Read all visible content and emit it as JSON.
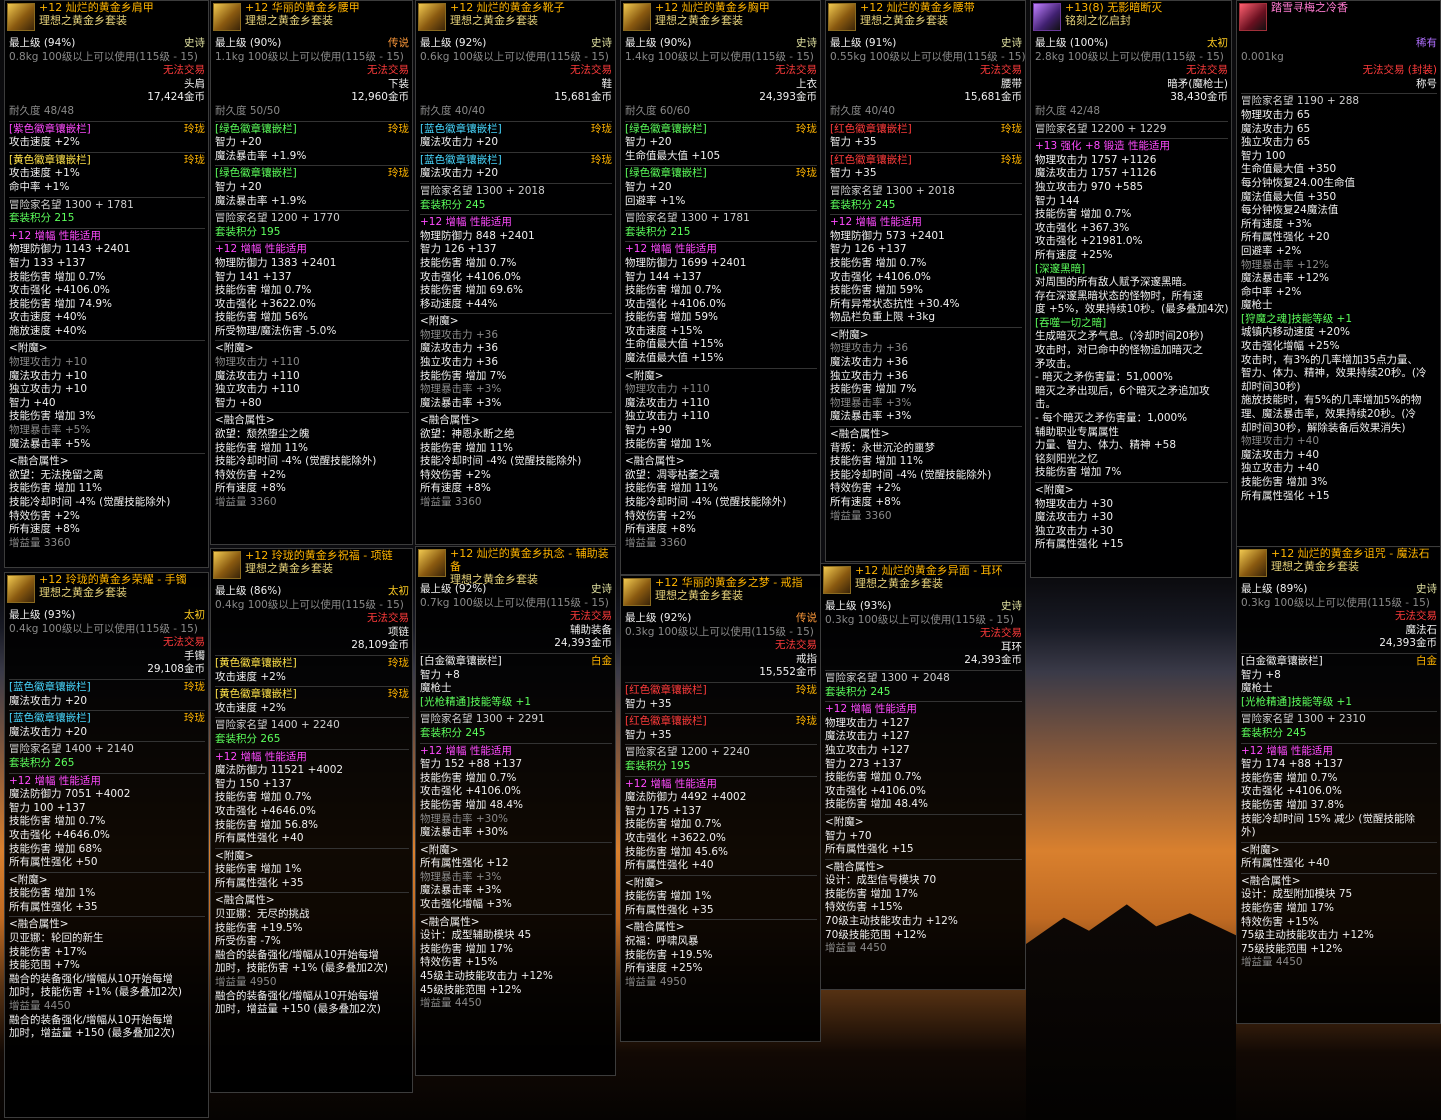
{
  "tips": [
    {
      "id": "shoulder",
      "title": "+12 灿烂的黄金乡肩甲",
      "set": "理想之黄金乡套装",
      "tier": "史诗",
      "level": "最上级",
      "pct": "(94%)",
      "weight": "0.8kg",
      "req": "100级以上可以使用(115级 - 15)",
      "trade": "无法交易",
      "slot": "头肩",
      "price": "17,424金币",
      "dur": "耐久度 48/48",
      "lines": [
        "[紫色徽章镶嵌栏]|玲珑",
        "攻击速度 +2%",
        "[黄色徽章镶嵌栏]|玲珑",
        "攻击速度 +1%",
        "命中率 +1%",
        "冒险家名望 1300 + 1781",
        "套装积分 215",
        "+12 增幅 性能适用",
        "物理防御力 1143 +2401",
        "智力 133 +137",
        "技能伤害 增加 0.7%",
        "攻击强化 +4106.0%",
        "技能伤害 增加 74.9%",
        "攻击速度 +40%",
        "施放速度 +40%",
        "<附魔>",
        "物理攻击力 +10",
        "魔法攻击力 +10",
        "独立攻击力 +10",
        "智力 +40",
        "技能伤害 增加 3%",
        "物理暴击率 +5%",
        "魔法暴击率 +5%",
        "<融合属性>",
        "欲望：无法挽留之离",
        "技能伤害 增加 11%",
        "技能冷却时间 -4% (觉醒技能除外)",
        "特效伤害 +2%",
        "所有速度 +8%",
        "增益量 3360"
      ]
    },
    {
      "id": "pants",
      "title": "+12 华丽的黄金乡腰甲",
      "set": "理想之黄金乡套装",
      "tier": "传说",
      "level": "最上级",
      "pct": "(90%)",
      "weight": "1.1kg",
      "req": "100级以上可以使用(115级 - 15)",
      "trade": "无法交易",
      "slot": "下装",
      "price": "12,960金币",
      "dur": "耐久度 50/50",
      "lines": [
        "[绿色徽章镶嵌栏]|玲珑",
        "智力 +20",
        "魔法暴击率 +1.9%",
        "[绿色徽章镶嵌栏]|玲珑",
        "智力 +20",
        "魔法暴击率 +1.9%",
        "冒险家名望 1200 + 1770",
        "套装积分 195",
        "+12 增幅 性能适用",
        "物理防御力 1383 +2401",
        "智力 141 +137",
        "技能伤害 增加 0.7%",
        "攻击强化 +3622.0%",
        "技能伤害 增加 56%",
        "所受物理/魔法伤害 -5.0%",
        "<附魔>",
        "物理攻击力 +110",
        "魔法攻击力 +110",
        "独立攻击力 +110",
        "智力 +80",
        "<融合属性>",
        "欲望：颓然堕尘之魄",
        "技能伤害 增加 11%",
        "技能冷却时间 -4% (觉醒技能除外)",
        "特效伤害 +2%",
        "所有速度 +8%",
        "增益量 3360"
      ]
    },
    {
      "id": "shoes",
      "title": "+12 灿烂的黄金乡靴子",
      "set": "理想之黄金乡套装",
      "tier": "史诗",
      "level": "最上级",
      "pct": "(92%)",
      "weight": "0.6kg",
      "req": "100级以上可以使用(115级 - 15)",
      "trade": "无法交易",
      "slot": "鞋",
      "price": "15,681金币",
      "dur": "耐久度 40/40",
      "lines": [
        "[蓝色徽章镶嵌栏]|玲珑",
        "魔法攻击力 +20",
        "[蓝色徽章镶嵌栏]|玲珑",
        "魔法攻击力 +20",
        "冒险家名望 1300 + 2018",
        "套装积分 245",
        "+12 增幅 性能适用",
        "物理防御力 848 +2401",
        "智力 126 +137",
        "技能伤害 增加 0.7%",
        "攻击强化 +4106.0%",
        "技能伤害 增加 69.6%",
        "移动速度 +44%",
        "<附魔>",
        "物理攻击力 +36",
        "魔法攻击力 +36",
        "独立攻击力 +36",
        "技能伤害 增加 7%",
        "物理暴击率 +3%",
        "魔法暴击率 +3%",
        "<融合属性>",
        "欲望：神恩永断之绝",
        "技能伤害 增加 11%",
        "技能冷却时间 -4% (觉醒技能除外)",
        "特效伤害 +2%",
        "所有速度 +8%",
        "增益量 3360"
      ]
    },
    {
      "id": "chest",
      "title": "+12 灿烂的黄金乡胸甲",
      "set": "理想之黄金乡套装",
      "tier": "史诗",
      "level": "最上级",
      "pct": "(90%)",
      "weight": "1.4kg",
      "req": "100级以上可以使用(115级 - 15)",
      "trade": "无法交易",
      "slot": "上衣",
      "price": "24,393金币",
      "dur": "耐久度 60/60",
      "lines": [
        "[绿色徽章镶嵌栏]|玲珑",
        "智力 +20",
        "生命值最大值 +105",
        "[绿色徽章镶嵌栏]|玲珑",
        "智力 +20",
        "回避率 +1%",
        "冒险家名望 1300 + 1781",
        "套装积分 215",
        "+12 增幅 性能适用",
        "物理防御力 1699 +2401",
        "智力 144 +137",
        "技能伤害 增加 0.7%",
        "攻击强化 +4106.0%",
        "技能伤害 增加 59%",
        "攻击速度 +15%",
        "生命值最大值 +15%",
        "魔法值最大值 +15%",
        "<附魔>",
        "物理攻击力 +110",
        "魔法攻击力 +110",
        "独立攻击力 +110",
        "智力 +90",
        "技能伤害 增加 1%",
        "<融合属性>",
        "欲望：凋零枯萎之魂",
        "技能伤害 增加 11%",
        "技能冷却时间 -4% (觉醒技能除外)",
        "特效伤害 +2%",
        "所有速度 +8%",
        "增益量 3360"
      ]
    },
    {
      "id": "belt",
      "title": "+12 灿烂的黄金乡腰带",
      "set": "理想之黄金乡套装",
      "tier": "史诗",
      "level": "最上级",
      "pct": "(91%)",
      "weight": "0.55kg",
      "req": "100级以上可以使用(115级 - 15)",
      "trade": "无法交易",
      "slot": "腰带",
      "price": "15,681金币",
      "dur": "耐久度 40/40",
      "lines": [
        "[红色徽章镶嵌栏]|玲珑",
        "智力 +35",
        "[红色徽章镶嵌栏]|玲珑",
        "智力 +35",
        "冒险家名望 1300 + 2018",
        "套装积分 245",
        "+12 增幅 性能适用",
        "物理防御力 573 +2401",
        "智力 126 +137",
        "技能伤害 增加 0.7%",
        "攻击强化 +4106.0%",
        "技能伤害 增加 59%",
        "所有异常状态抗性 +30.4%",
        "物品栏负重上限 +3kg",
        "<附魔>",
        "物理攻击力 +36",
        "魔法攻击力 +36",
        "独立攻击力 +36",
        "技能伤害 增加 7%",
        "物理暴击率 +3%",
        "魔法暴击率 +3%",
        "<融合属性>",
        "背叛：永世沉沦的噩梦",
        "技能伤害 增加 11%",
        "技能冷却时间 -4% (觉醒技能除外)",
        "特效伤害 +2%",
        "所有速度 +8%",
        "增益量 3360"
      ]
    },
    {
      "id": "weapon",
      "title": "+13(8) 无影暗断灭",
      "set": "铭刻之忆启封",
      "tier": "太初",
      "level": "最上级",
      "pct": "(100%)",
      "weight": "2.8kg",
      "req": "100级以上可以使用(115级 - 15)",
      "trade": "无法交易",
      "slot": "暗矛(魔枪士)",
      "price": "38,430金币",
      "dur": "耐久度 42/48",
      "lines": [
        "冒险家名望 12200 + 1229",
        "+13 强化 +8 锻造 性能适用",
        "物理攻击力 1757 +1126",
        "魔法攻击力 1757 +1126",
        "独立攻击力 970 +585",
        "智力 144",
        "技能伤害 增加 0.7%",
        "攻击强化 +367.3%",
        "攻击强化 +21981.0%",
        "所有速度 +25%",
        "[深邃黑暗]",
        "对周围的所有敌人赋予深邃黑暗。",
        "存在深邃黑暗状态的怪物时，所有速",
        "度 +5%，效果持续10秒。(最多叠加4次)",
        "[吞噬一切之暗]",
        "生成暗灭之矛气息。(冷却时间20秒)",
        "攻击时，对已命中的怪物追加暗灭之",
        "矛攻击。",
        "- 暗灭之矛伤害量：51,000%",
        "暗灭之矛出现后，6个暗灭之矛追加攻",
        "击。",
        "- 每个暗灭之矛伤害量：1,000%",
        "辅助职业专属属性",
        "力量、智力、体力、精神 +58",
        "铭刻阳光之忆",
        "技能伤害 增加 7%",
        "<附魔>",
        "物理攻击力 +30",
        "魔法攻击力 +30",
        "独立攻击力 +30",
        "所有属性强化 +15"
      ]
    },
    {
      "id": "title",
      "title": "踏雪寻梅之冷香",
      "set": "",
      "tier": "稀有",
      "level": "",
      "pct": "",
      "weight": "0.001kg",
      "req": "",
      "trade": "无法交易 (封装)",
      "slot": "称号",
      "price": "",
      "dur": "",
      "lines": [
        "冒险家名望 1190 + 288",
        "物理攻击力 65",
        "魔法攻击力 65",
        "独立攻击力 65",
        "智力 100",
        "生命值最大值 +350",
        "每分钟恢复24.00生命值",
        "魔法值最大值 +350",
        "每分钟恢复24魔法值",
        "所有速度 +3%",
        "所有属性强化 +20",
        "回避率 +2%",
        "物理暴击率 +12%",
        "魔法暴击率 +12%",
        "命中率 +2%",
        "魔枪士",
        "[狩魔之魂]技能等级 +1",
        "城镇内移动速度 +20%",
        "攻击强化增幅 +25%",
        "攻击时，有3%的几率增加35点力量、",
        "智力、体力、精神，效果持续20秒。(冷",
        "却时间30秒)",
        "施放技能时，有5%的几率增加5%的物",
        "理、魔法暴击率，效果持续20秒。(冷",
        "却时间30秒，解除装备后效果消失)",
        "物理攻击力 +40",
        "魔法攻击力 +40",
        "独立攻击力 +40",
        "技能伤害 增加 3%",
        "所有属性强化 +15"
      ]
    },
    {
      "id": "bracelet",
      "title": "+12 玲珑的黄金乡荣耀 - 手镯",
      "set": "理想之黄金乡套装",
      "tier": "太初",
      "level": "最上级",
      "pct": "(93%)",
      "weight": "0.4kg",
      "req": "100级以上可以使用(115级 - 15)",
      "trade": "无法交易",
      "slot": "手镯",
      "price": "29,108金币",
      "dur": "",
      "lines": [
        "[蓝色徽章镶嵌栏]|玲珑",
        "魔法攻击力 +20",
        "[蓝色徽章镶嵌栏]|玲珑",
        "魔法攻击力 +20",
        "冒险家名望 1400 + 2140",
        "套装积分 265",
        "+12 增幅 性能适用",
        "魔法防御力 7051 +4002",
        "智力 100 +137",
        "技能伤害 增加 0.7%",
        "攻击强化 +4646.0%",
        "技能伤害 增加 68%",
        "所有属性强化 +50",
        "<附魔>",
        "技能伤害 增加 1%",
        "所有属性强化 +35",
        "<融合属性>",
        "贝亚娜：轮回的新生",
        "技能伤害 +17%",
        "技能范围 +7%",
        "融合的装备强化/增幅从10开始每增",
        "加时，技能伤害 +1% (最多叠加2次)",
        "增益量 4450",
        "融合的装备强化/增幅从10开始每增",
        "加时，增益量 +150 (最多叠加2次)"
      ]
    },
    {
      "id": "necklace",
      "title": "+12 玲珑的黄金乡祝福 - 项链",
      "set": "理想之黄金乡套装",
      "tier": "太初",
      "level": "最上级",
      "pct": "(86%)",
      "weight": "0.4kg",
      "req": "100级以上可以使用(115级 - 15)",
      "trade": "无法交易",
      "slot": "项链",
      "price": "28,109金币",
      "dur": "",
      "lines": [
        "[黄色徽章镶嵌栏]|玲珑",
        "攻击速度 +2%",
        "[黄色徽章镶嵌栏]|玲珑",
        "攻击速度 +2%",
        "冒险家名望 1400 + 2240",
        "套装积分 265",
        "+12 增幅 性能适用",
        "魔法防御力 11521 +4002",
        "智力 150 +137",
        "技能伤害 增加 0.7%",
        "攻击强化 +4646.0%",
        "技能伤害 增加 56.8%",
        "所有属性强化 +40",
        "<附魔>",
        "技能伤害 增加 1%",
        "所有属性强化 +35",
        "<融合属性>",
        "贝亚娜：无尽的挑战",
        "技能伤害 +19.5%",
        "所受伤害 -7%",
        "融合的装备强化/增幅从10开始每增",
        "加时，技能伤害 +1% (最多叠加2次)",
        "增益量 4950",
        "融合的装备强化/增幅从10开始每增",
        "加时，增益量 +150 (最多叠加2次)"
      ]
    },
    {
      "id": "support",
      "title": "+12 灿烂的黄金乡执念 - 辅助装备",
      "set": "理想之黄金乡套装",
      "tier": "史诗",
      "level": "最上级",
      "pct": "(92%)",
      "weight": "0.7kg",
      "req": "100级以上可以使用(115级 - 15)",
      "trade": "无法交易",
      "slot": "辅助装备",
      "price": "24,393金币",
      "dur": "",
      "lines": [
        "[白金徽章镶嵌栏]|白金",
        "智力 +8",
        "魔枪士",
        "[光枪精通]技能等级 +1",
        "冒险家名望 1300 + 2291",
        "套装积分 245",
        "+12 增幅 性能适用",
        "智力 152 +88 +137",
        "技能伤害 增加 0.7%",
        "攻击强化 +4106.0%",
        "技能伤害 增加 48.4%",
        "物理暴击率 +30%",
        "魔法暴击率 +30%",
        "<附魔>",
        "所有属性强化 +12",
        "物理暴击率 +3%",
        "魔法暴击率 +3%",
        "攻击强化增幅 +3%",
        "<融合属性>",
        "设计：成型辅助模块 45",
        "技能伤害 增加 17%",
        "特效伤害 +15%",
        "45级主动技能攻击力 +12%",
        "45级技能范围 +12%",
        "增益量 4450"
      ]
    },
    {
      "id": "ring",
      "title": "+12 华丽的黄金乡之梦 - 戒指",
      "set": "理想之黄金乡套装",
      "tier": "传说",
      "level": "最上级",
      "pct": "(92%)",
      "weight": "0.3kg",
      "req": "100级以上可以使用(115级 - 15)",
      "trade": "无法交易",
      "slot": "戒指",
      "price": "15,552金币",
      "dur": "",
      "lines": [
        "[红色徽章镶嵌栏]|玲珑",
        "智力 +35",
        "[红色徽章镶嵌栏]|玲珑",
        "智力 +35",
        "冒险家名望 1200 + 2240",
        "套装积分 195",
        "+12 增幅 性能适用",
        "魔法防御力 4492 +4002",
        "智力 175 +137",
        "技能伤害 增加 0.7%",
        "攻击强化 +3622.0%",
        "技能伤害 增加 45.6%",
        "所有属性强化 +40",
        "<附魔>",
        "技能伤害 增加 1%",
        "所有属性强化 +35",
        "<融合属性>",
        "祝福：呼啸风暴",
        "技能伤害 +19.5%",
        "所有速度 +25%",
        "增益量 4950"
      ]
    },
    {
      "id": "earring",
      "title": "+12 灿烂的黄金乡异面 - 耳环",
      "set": "理想之黄金乡套装",
      "tier": "史诗",
      "level": "最上级",
      "pct": "(93%)",
      "weight": "0.3kg",
      "req": "100级以上可以使用(115级 - 15)",
      "trade": "无法交易",
      "slot": "耳环",
      "price": "24,393金币",
      "dur": "",
      "lines": [
        "冒险家名望 1300 + 2048",
        "套装积分 245",
        "+12 增幅 性能适用",
        "物理攻击力 +127",
        "魔法攻击力 +127",
        "独立攻击力 +127",
        "智力 273 +137",
        "技能伤害 增加 0.7%",
        "攻击强化 +4106.0%",
        "技能伤害 增加 48.4%",
        "<附魔>",
        "智力 +70",
        "所有属性强化 +15",
        "<融合属性>",
        "设计：成型信号模块 70",
        "技能伤害 增加 17%",
        "特效伤害 +15%",
        "70级主动技能攻击力 +12%",
        "70级技能范围 +12%",
        "增益量 4450"
      ]
    },
    {
      "id": "stone",
      "title": "+12 灿烂的黄金乡诅咒 - 魔法石",
      "set": "理想之黄金乡套装",
      "tier": "史诗",
      "level": "最上级",
      "pct": "(89%)",
      "weight": "0.3kg",
      "req": "100级以上可以使用(115级 - 15)",
      "trade": "无法交易",
      "slot": "魔法石",
      "price": "24,393金币",
      "dur": "",
      "lines": [
        "[白金徽章镶嵌栏]|白金",
        "智力 +8",
        "魔枪士",
        "[光枪精通]技能等级 +1",
        "冒险家名望 1300 + 2310",
        "套装积分 245",
        "+12 增幅 性能适用",
        "智力 174 +88 +137",
        "技能伤害 增加 0.7%",
        "攻击强化 +4106.0%",
        "技能伤害 增加 37.8%",
        "技能冷却时间 15% 减少 (觉醒技能除",
        "外)",
        "<附魔>",
        "所有属性强化 +40",
        "<融合属性>",
        "设计：成型附加模块 75",
        "技能伤害 增加 17%",
        "特效伤害 +15%",
        "75级主动技能攻击力 +12%",
        "75级技能范围 +12%",
        "增益量 4450"
      ]
    }
  ]
}
